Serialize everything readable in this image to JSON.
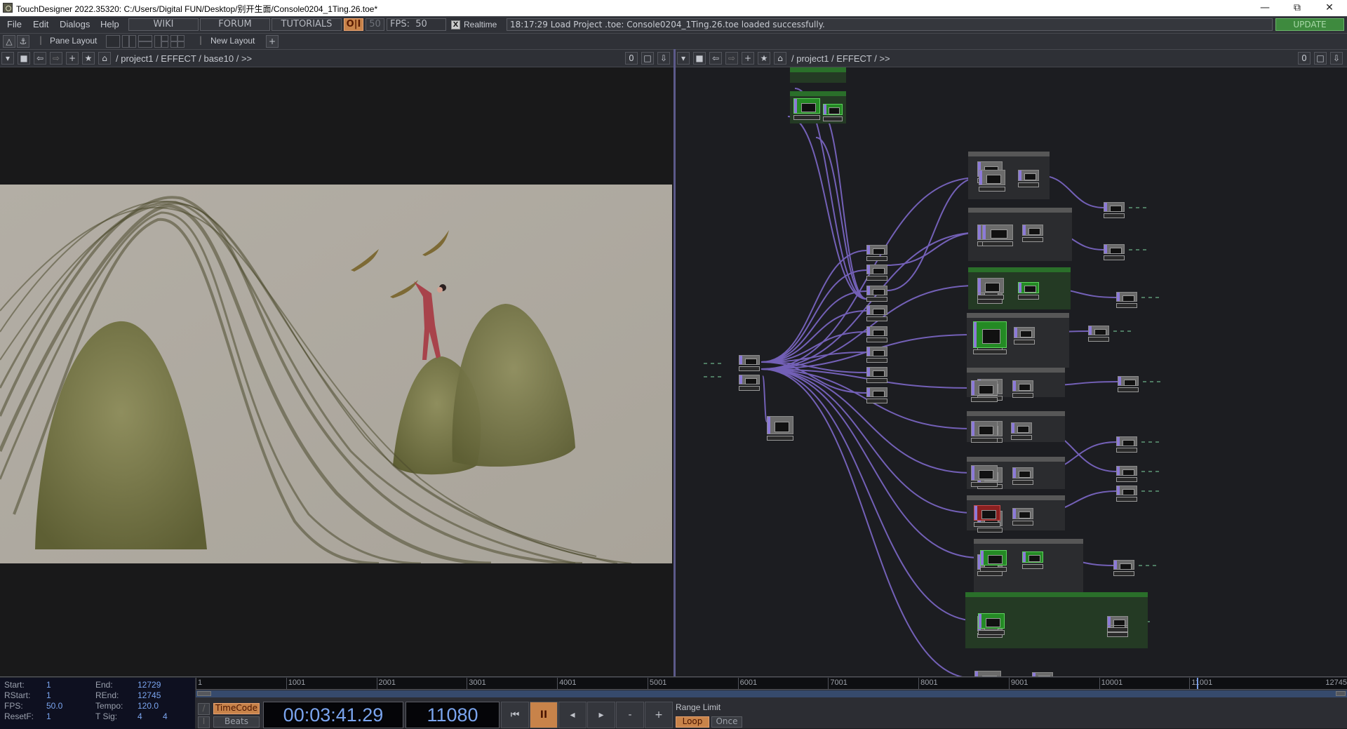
{
  "window": {
    "title": "TouchDesigner 2022.35320: C:/Users/Digital FUN/Desktop/别开生面/Console0204_1Ting.26.toe*",
    "controls": [
      "minimize",
      "restore",
      "close"
    ]
  },
  "menubar": {
    "menus": [
      "File",
      "Edit",
      "Dialogs",
      "Help"
    ],
    "links": [
      "WIKI",
      "FORUM",
      "TUTORIALS"
    ],
    "power_toggle": "O|I",
    "fps_setting": "50",
    "fps_label": "FPS:",
    "fps_value": "50",
    "realtime_checked": "X",
    "realtime_label": "Realtime",
    "status_message": "18:17:29 Load Project .toe: Console0204_1Ting.26.toe loaded successfully.",
    "update_label": "UPDATE"
  },
  "layoutbar": {
    "pane_layout_label": "Pane Layout",
    "new_layout_label": "New Layout",
    "add_label": "+"
  },
  "left_pane": {
    "path": "/ project1 / EFFECT / base10 / >>",
    "counter": "0",
    "viewer_content": "Artwork: long hair-like strands sweeping over mountain shapes, figure in red reaching toward three birds"
  },
  "right_pane": {
    "path": "/ project1 / EFFECT / >>",
    "counter": "0",
    "network": {
      "note": "Network editor of operators connected by purple wires; node labels illegible at this resolution"
    }
  },
  "nav_icons": [
    "menu-down",
    "stop",
    "back",
    "forward",
    "plus",
    "star",
    "home"
  ],
  "bottom": {
    "range": {
      "start_label": "Start:",
      "start": "1",
      "end_label": "End:",
      "end": "12729",
      "rstart_label": "RStart:",
      "rstart": "1",
      "rend_label": "REnd:",
      "rend": "12745",
      "fps_label": "FPS:",
      "fps": "50.0",
      "tempo_label": "Tempo:",
      "tempo": "120.0",
      "resetf_label": "ResetF:",
      "resetf": "1",
      "tsig_label": "T Sig:",
      "tsig_num": "4",
      "tsig_den": "4"
    },
    "ruler_ticks": [
      "1",
      "1001",
      "2001",
      "3001",
      "4001",
      "5001",
      "6001",
      "7001",
      "8001",
      "9001",
      "10001",
      "11001",
      "12745"
    ],
    "playhead_frame": 11080,
    "timeline_end": 12745,
    "mode_buttons": {
      "timecode": "TimeCode",
      "beats": "Beats"
    },
    "timecode": "00:03:41.29",
    "frame": "11080",
    "transport": {
      "rewind": "⏮",
      "pause": "II",
      "step_back": "◂",
      "step_forward": "▸",
      "minus": "-",
      "plus": "+"
    },
    "range_limit_label": "Range Limit",
    "loop_label": "Loop",
    "once_label": "Once"
  }
}
